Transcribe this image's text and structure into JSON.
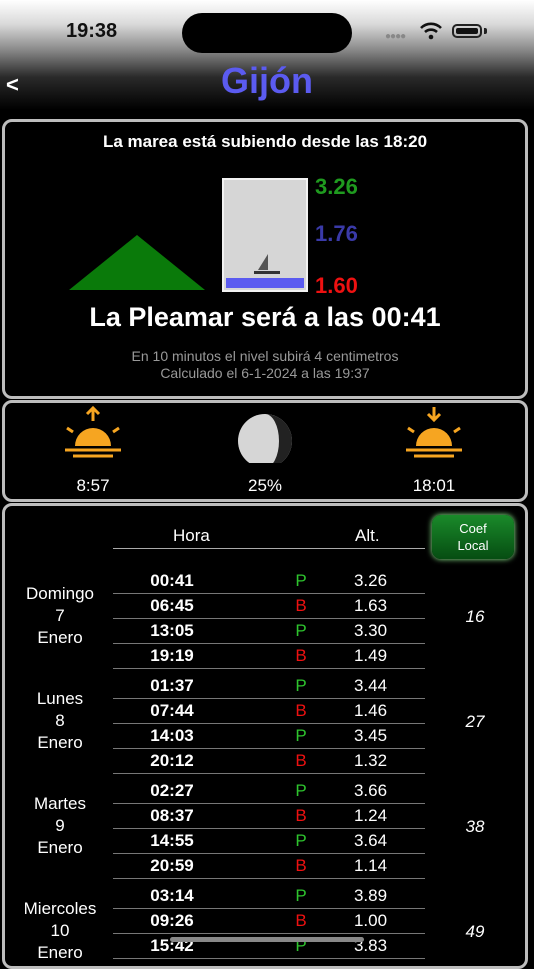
{
  "status": {
    "time": "19:38"
  },
  "header": {
    "back": "<",
    "title": "Gijón"
  },
  "tide": {
    "state": "La marea está subiendo desde las 18:20",
    "level_high": "3.26",
    "level_current": "1.76",
    "level_low": "1.60",
    "fill_fraction": 0.09,
    "next": "La Pleamar será a las 00:41",
    "forecast": "En 10 minutos el nivel subirá 4 centimetros",
    "calculated": "Calculado el 6-1-2024 a las 19:37"
  },
  "sun": {
    "sunrise": "8:57",
    "moon": "25%",
    "sunset": "18:01"
  },
  "table": {
    "col_hora": "Hora",
    "col_alt": "Alt.",
    "coef_label_1": "Coef",
    "coef_label_2": "Local",
    "days": [
      {
        "name": "Domingo",
        "num": "7",
        "month": "Enero",
        "coef": "16",
        "rows": [
          {
            "time": "00:41",
            "type": "P",
            "height": "3.26"
          },
          {
            "time": "06:45",
            "type": "B",
            "height": "1.63"
          },
          {
            "time": "13:05",
            "type": "P",
            "height": "3.30"
          },
          {
            "time": "19:19",
            "type": "B",
            "height": "1.49"
          }
        ]
      },
      {
        "name": "Lunes",
        "num": "8",
        "month": "Enero",
        "coef": "27",
        "rows": [
          {
            "time": "01:37",
            "type": "P",
            "height": "3.44"
          },
          {
            "time": "07:44",
            "type": "B",
            "height": "1.46"
          },
          {
            "time": "14:03",
            "type": "P",
            "height": "3.45"
          },
          {
            "time": "20:12",
            "type": "B",
            "height": "1.32"
          }
        ]
      },
      {
        "name": "Martes",
        "num": "9",
        "month": "Enero",
        "coef": "38",
        "rows": [
          {
            "time": "02:27",
            "type": "P",
            "height": "3.66"
          },
          {
            "time": "08:37",
            "type": "B",
            "height": "1.24"
          },
          {
            "time": "14:55",
            "type": "P",
            "height": "3.64"
          },
          {
            "time": "20:59",
            "type": "B",
            "height": "1.14"
          }
        ]
      },
      {
        "name": "Miercoles",
        "num": "10",
        "month": "Enero",
        "coef": "49",
        "rows": [
          {
            "time": "03:14",
            "type": "P",
            "height": "3.89"
          },
          {
            "time": "09:26",
            "type": "B",
            "height": "1.00"
          },
          {
            "time": "15:42",
            "type": "P",
            "height": "3.83"
          }
        ]
      }
    ]
  }
}
